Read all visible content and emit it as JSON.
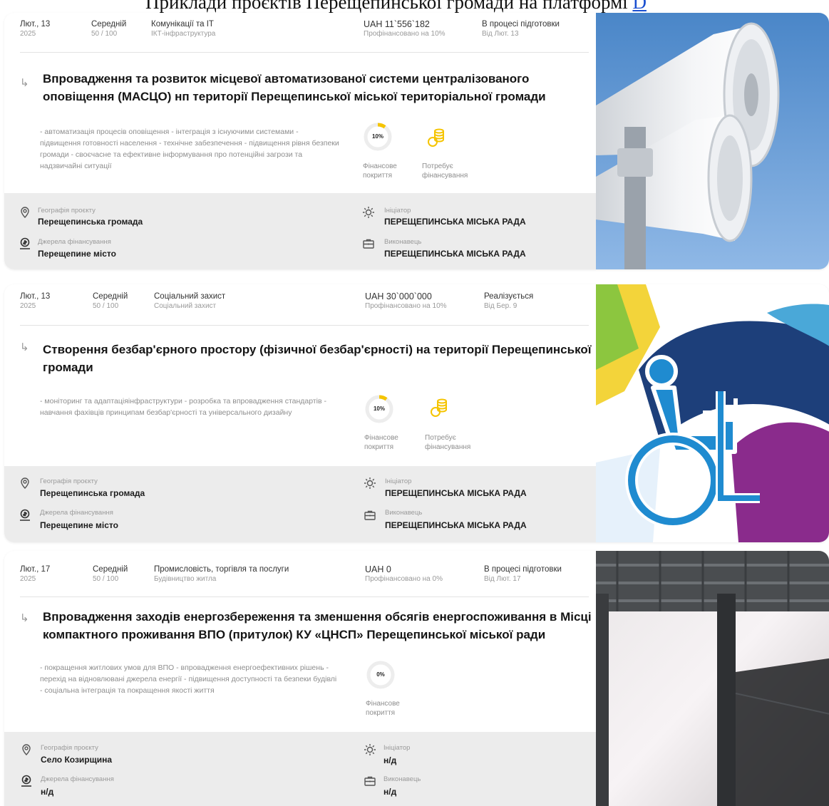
{
  "page": {
    "heading": "Приклади проєктів Перещепинської громади на платформі ",
    "heading_link": "D"
  },
  "labels": {
    "geography": "Географія проєкту",
    "funding_sources": "Джерела фінансування",
    "initiator": "Ініціатор",
    "executor": "Виконавець",
    "financial_coverage": "Фінансове покриття",
    "needs_funding": "Потребує фінансування"
  },
  "projects": [
    {
      "date": "Лют., 13",
      "year": "2025",
      "level": "Середній",
      "score": "50 / 100",
      "category": "Комунікації та IT",
      "subcategory": "ІКТ-інфраструктура",
      "amount": "UAH  11`556`182",
      "funded": "Профінансовано на 10%",
      "status": "В процесі підготовки",
      "status_since": "Від Лют. 13",
      "title": "Впровадження та розвиток місцевої автоматизованої системи централізованого оповіщення (МАСЦО) нп території Перещепинської міської територіальної громади",
      "description": "- автоматизація процесів оповіщення - інтеграція з існуючими системами - підвищення готовності населення - технічне забезпечення - підвищення рівня безпеки громади - своєчасне та ефективне інформування про потенційні загрози та надзвичайні ситуації",
      "coverage_percent": 10,
      "coverage_label": "10%",
      "geography": "Перещепинська громада",
      "funding_source": "Перещепине місто",
      "initiator": "ПЕРЕЩЕПИНСЬКА МІСЬКА РАДА",
      "executor": "ПЕРЕЩЕПИНСЬКА МІСЬКА РАДА"
    },
    {
      "date": "Лют., 13",
      "year": "2025",
      "level": "Середній",
      "score": "50 / 100",
      "category": "Соціальний захист",
      "subcategory": "Соціальний захист",
      "amount": "UAH  30`000`000",
      "funded": "Профінансовано на 10%",
      "status": "Реалізується",
      "status_since": "Від Бер. 9",
      "title": "Створення безбар'єрного простору (фізичної безбар'єрності) на території Перещепинської громади",
      "description": "- моніторинг та адаптаціяінфраструктури - розробка та впровадження стандартів - навчання фахівців принципам безбар'єрності та універсального дизайну",
      "coverage_percent": 10,
      "coverage_label": "10%",
      "geography": "Перещепинська громада",
      "funding_source": "Перещепине місто",
      "initiator": "ПЕРЕЩЕПИНСЬКА МІСЬКА РАДА",
      "executor": "ПЕРЕЩЕПИНСЬКА МІСЬКА РАДА"
    },
    {
      "date": "Лют., 17",
      "year": "2025",
      "level": "Середній",
      "score": "50 / 100",
      "category": "Промисловість, торгівля та послуги",
      "subcategory": "Будівництво житла",
      "amount": "UAH  0",
      "funded": "Профінансовано на 0%",
      "status": "В процесі підготовки",
      "status_since": "Від Лют. 17",
      "title": "Впровадження заходів енергозбереження та зменшення обсягів енергоспоживання в Місці компактного проживання ВПО (притулок) КУ «ЦНСП» Перещепинської міської ради",
      "description": "- покращення житлових умов для ВПО - впровадження енергоефективних рішень - перехід на відновлювані джерела енергії - підвищення доступності та безпеки будівлі - соціальна інтеграція та покращення якості життя",
      "coverage_percent": 0,
      "coverage_label": "0%",
      "geography": "Село Козирщина",
      "funding_source": "н/д",
      "initiator": "н/д",
      "executor": "н/д"
    }
  ],
  "colors": {
    "accent": "#f5c400",
    "card_info_bg": "#ececec",
    "ring_bg": "#ededed"
  },
  "icons": [
    "reply-arrow-icon",
    "location-pin-icon",
    "money-hand-icon",
    "sun-icon",
    "briefcase-icon",
    "coins-icon",
    "megaphone-image",
    "wheelchair-image",
    "room-image"
  ]
}
